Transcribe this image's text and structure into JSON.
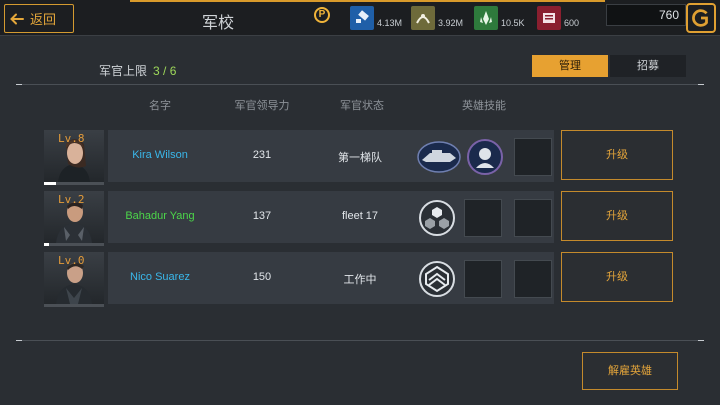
{
  "header": {
    "back_label": "返回",
    "title": "军校",
    "help_icon_text": "P",
    "resources": [
      {
        "name": "blue-resource-icon",
        "value": "4.13M",
        "color": "#1f5fa8"
      },
      {
        "name": "olive-resource-icon",
        "value": "3.92M",
        "color": "#6e6a3a"
      },
      {
        "name": "green-resource-icon",
        "value": "10.5K",
        "color": "#2e7a3c"
      },
      {
        "name": "red-resource-icon",
        "value": "600",
        "color": "#8a1f2f"
      }
    ],
    "credits": "760"
  },
  "academy": {
    "limit_label": "军官上限",
    "limit_value": "3 / 6",
    "tabs": [
      {
        "label": "管理",
        "active": true
      },
      {
        "label": "招募",
        "active": false
      }
    ],
    "columns": [
      "名字",
      "军官领导力",
      "军官状态",
      "英雄技能"
    ],
    "officers": [
      {
        "level": "Lv.8",
        "name": "Kira Wilson",
        "name_color": "#3ab7ea",
        "leadership": "231",
        "status": "第一梯队",
        "xp_fraction": 0.2,
        "skills": [
          "ship-skill-icon",
          "commander-skill-icon",
          "empty"
        ],
        "upgrade_label": "升级"
      },
      {
        "level": "Lv.2",
        "name": "Bahadur Yang",
        "name_color": "#4cd64a",
        "leadership": "137",
        "status": "fleet 17",
        "xp_fraction": 0.08,
        "skills": [
          "hexagon-skill-icon",
          "empty",
          "empty"
        ],
        "upgrade_label": "升级"
      },
      {
        "level": "Lv.0",
        "name": "Nico Suarez",
        "name_color": "#3ab7ea",
        "leadership": "150",
        "status": "工作中",
        "xp_fraction": 0.0,
        "skills": [
          "chevron-skill-icon",
          "empty",
          "empty"
        ],
        "upgrade_label": "升级"
      }
    ],
    "dismiss_label": "解雇英雄"
  }
}
